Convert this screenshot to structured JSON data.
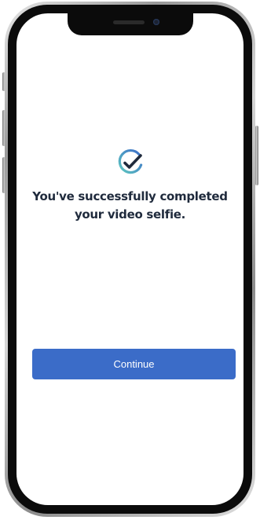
{
  "message": {
    "text": "You've successfully completed your video selfie."
  },
  "actions": {
    "continue_label": "Continue"
  },
  "icons": {
    "success": "check-circle-icon"
  },
  "colors": {
    "button": "#3b6cc8",
    "text": "#1f2a3c",
    "icon_check": "#1f2a3c",
    "icon_ring_start": "#5ec7c0",
    "icon_ring_end": "#3b6cc8"
  }
}
